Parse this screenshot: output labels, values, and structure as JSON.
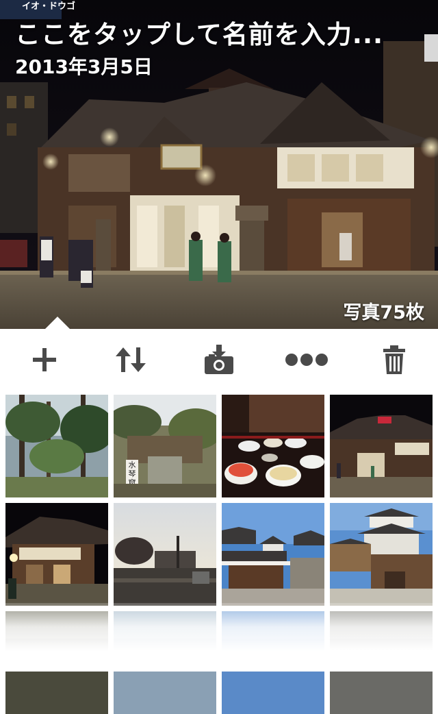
{
  "album": {
    "title": "ここをタップして名前を入力...",
    "date": "2013年3月5日",
    "photo_count": "写真75枚",
    "sign_text": "イオ・ドウゴ"
  },
  "toolbar": {
    "items": [
      {
        "name": "add",
        "icon": "plus-icon"
      },
      {
        "name": "sort",
        "icon": "sort-arrows-icon"
      },
      {
        "name": "import",
        "icon": "camera-download-icon"
      },
      {
        "name": "more",
        "icon": "ellipsis-icon"
      },
      {
        "name": "delete",
        "icon": "trash-icon"
      }
    ],
    "icon_color": "#4a4a4a"
  },
  "thumbnails": [
    {
      "subject": "garden-trees"
    },
    {
      "subject": "stone-monument-garden",
      "sign_text": "水琴窟"
    },
    {
      "subject": "meal-on-table"
    },
    {
      "subject": "dogo-onsen-night"
    },
    {
      "subject": "onsen-annex-night"
    },
    {
      "subject": "dusk-path"
    },
    {
      "subject": "castle-walls-blue-sky"
    },
    {
      "subject": "castle-tower"
    },
    {
      "subject": "faded-row-1"
    },
    {
      "subject": "faded-row-2"
    },
    {
      "subject": "faded-row-3"
    },
    {
      "subject": "faded-row-4"
    }
  ]
}
